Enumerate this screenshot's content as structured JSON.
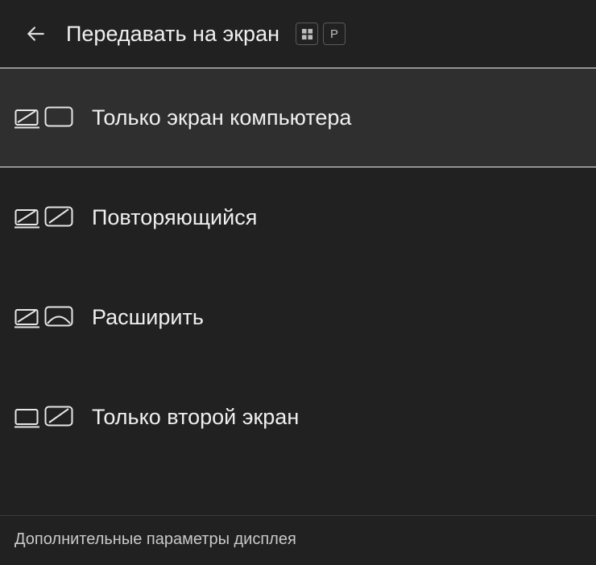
{
  "header": {
    "title": "Передавать на экран",
    "shortcut_key": "P"
  },
  "options": [
    {
      "id": "pc-only",
      "label": "Только экран компьютера",
      "selected": true,
      "icon": "pc-only"
    },
    {
      "id": "duplicate",
      "label": "Повторяющийся",
      "selected": false,
      "icon": "duplicate"
    },
    {
      "id": "extend",
      "label": "Расширить",
      "selected": false,
      "icon": "extend"
    },
    {
      "id": "second-only",
      "label": "Только второй экран",
      "selected": false,
      "icon": "second"
    }
  ],
  "footer": {
    "more_settings": "Дополнительные параметры дисплея"
  }
}
